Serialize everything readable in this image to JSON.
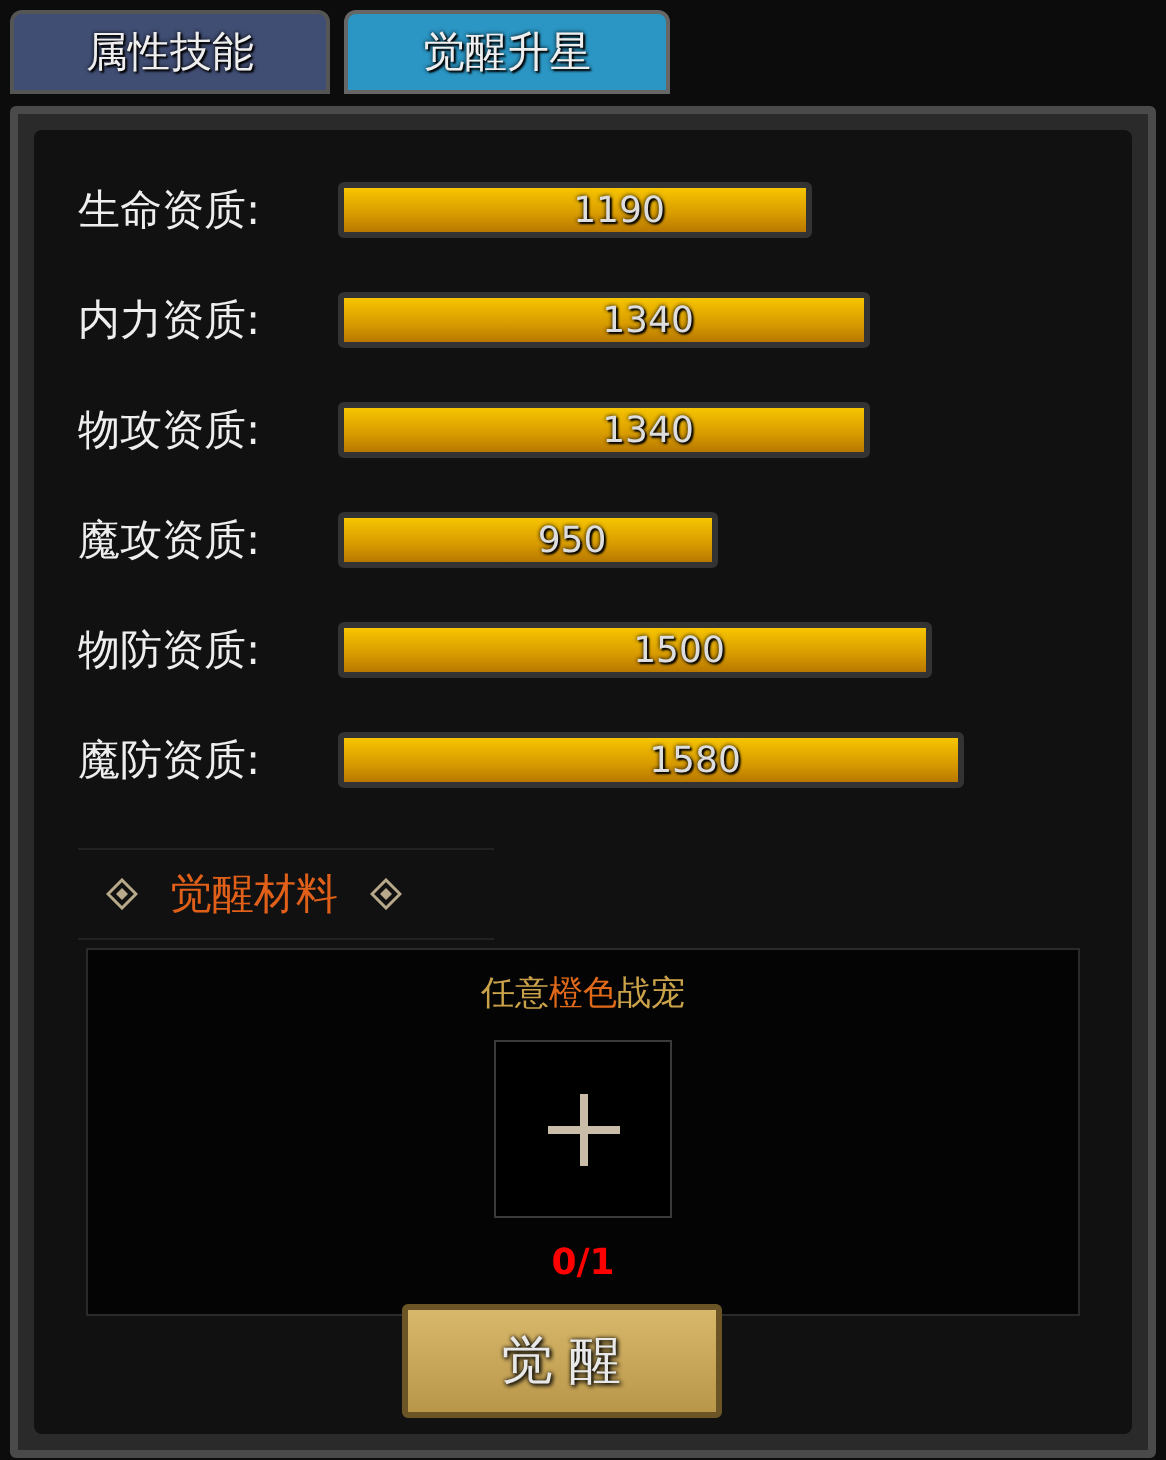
{
  "tabs": [
    {
      "label": "属性技能",
      "selected": false
    },
    {
      "label": "觉醒升星",
      "selected": true
    }
  ],
  "attributes": [
    {
      "label": "生命资质:",
      "value": "1190"
    },
    {
      "label": "内力资质:",
      "value": "1340"
    },
    {
      "label": "物攻资质:",
      "value": "1340"
    },
    {
      "label": "魔攻资质:",
      "value": "950"
    },
    {
      "label": "物防资质:",
      "value": "1500"
    },
    {
      "label": "魔防资质:",
      "value": "1580"
    }
  ],
  "materials": {
    "title": "觉醒材料",
    "hint": "任意**橙色**战宠",
    "count": "0/1"
  },
  "button": "觉 醒"
}
